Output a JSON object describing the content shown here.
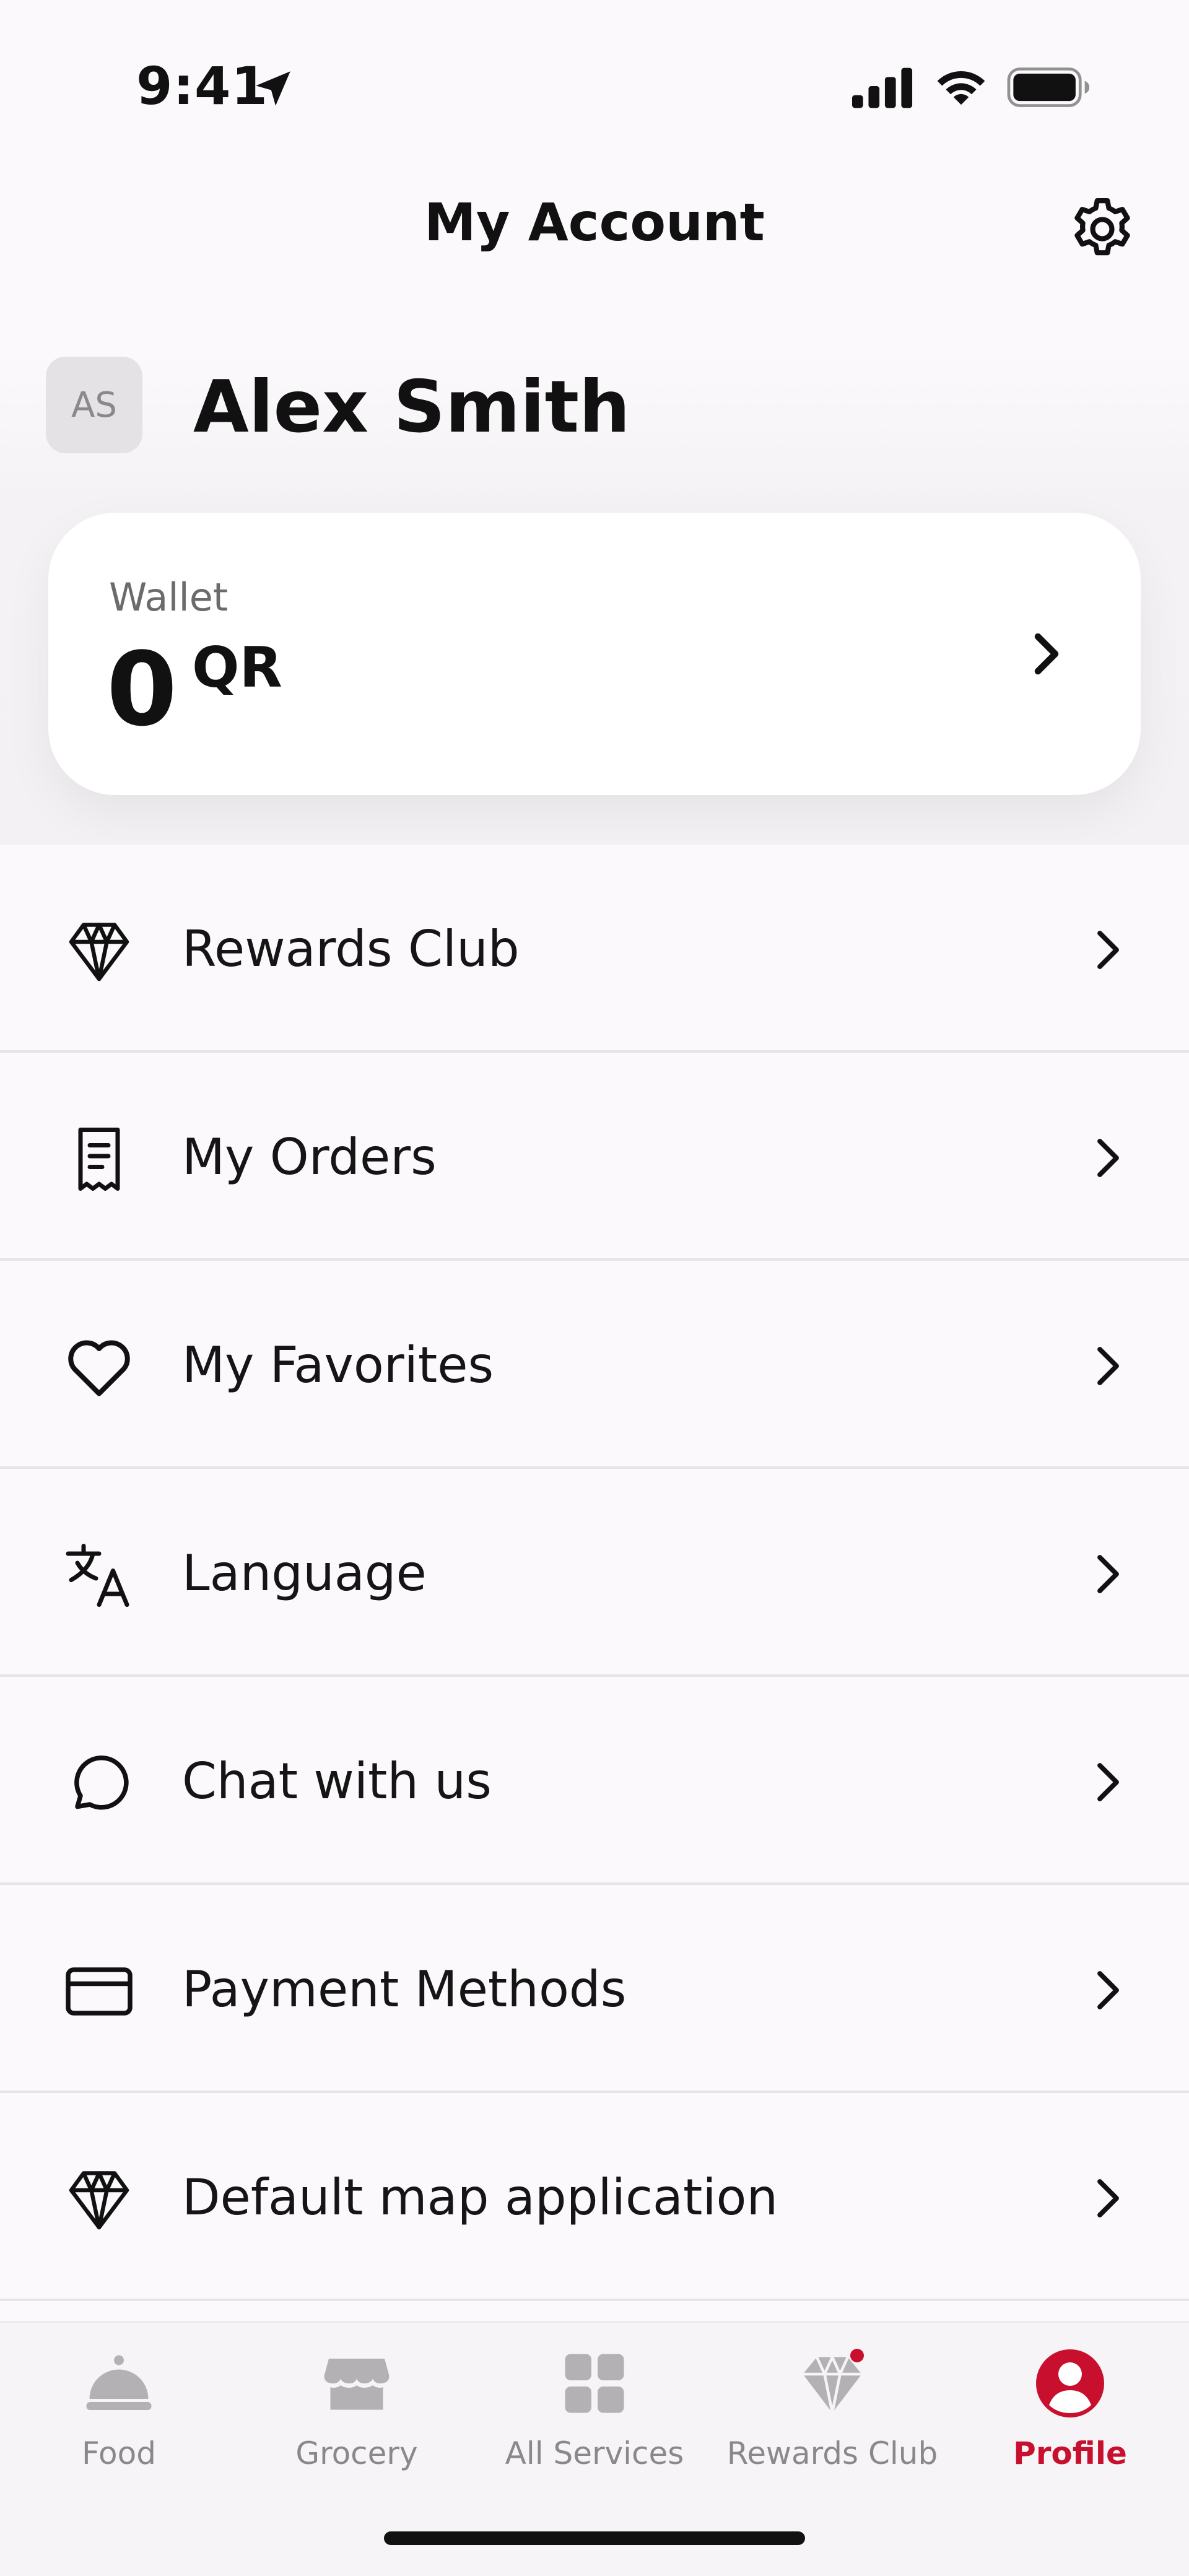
{
  "status_bar": {
    "time": "9:41",
    "icons": [
      "location-arrow-icon",
      "cellular-signal-icon",
      "wifi-icon",
      "battery-icon"
    ]
  },
  "header": {
    "title": "My Account",
    "settings_icon": "gear-icon"
  },
  "profile": {
    "initials": "AS",
    "name": "Alex Smith"
  },
  "wallet": {
    "label": "Wallet",
    "amount": "0",
    "currency": "QR"
  },
  "menu": {
    "items": [
      {
        "label": "Rewards Club",
        "icon": "diamond-icon"
      },
      {
        "label": "My Orders",
        "icon": "receipt-icon"
      },
      {
        "label": "My Favorites",
        "icon": "heart-icon"
      },
      {
        "label": "Language",
        "icon": "translate-icon"
      },
      {
        "label": "Chat with us",
        "icon": "chat-bubble-icon"
      },
      {
        "label": "Payment Methods",
        "icon": "credit-card-icon"
      },
      {
        "label": "Default map application",
        "icon": "diamond-icon"
      }
    ]
  },
  "bottom_nav": {
    "items": [
      {
        "label": "Food",
        "icon": "cloche-icon"
      },
      {
        "label": "Grocery",
        "icon": "store-icon"
      },
      {
        "label": "All Services",
        "icon": "grid-icon"
      },
      {
        "label": "Rewards Club",
        "icon": "diamond-icon"
      },
      {
        "label": "Profile",
        "icon": "person-icon"
      }
    ],
    "active": "Profile"
  },
  "colors": {
    "accent": "#c8102e",
    "inactive": "#8a888a",
    "background": "#fbf9fb"
  }
}
